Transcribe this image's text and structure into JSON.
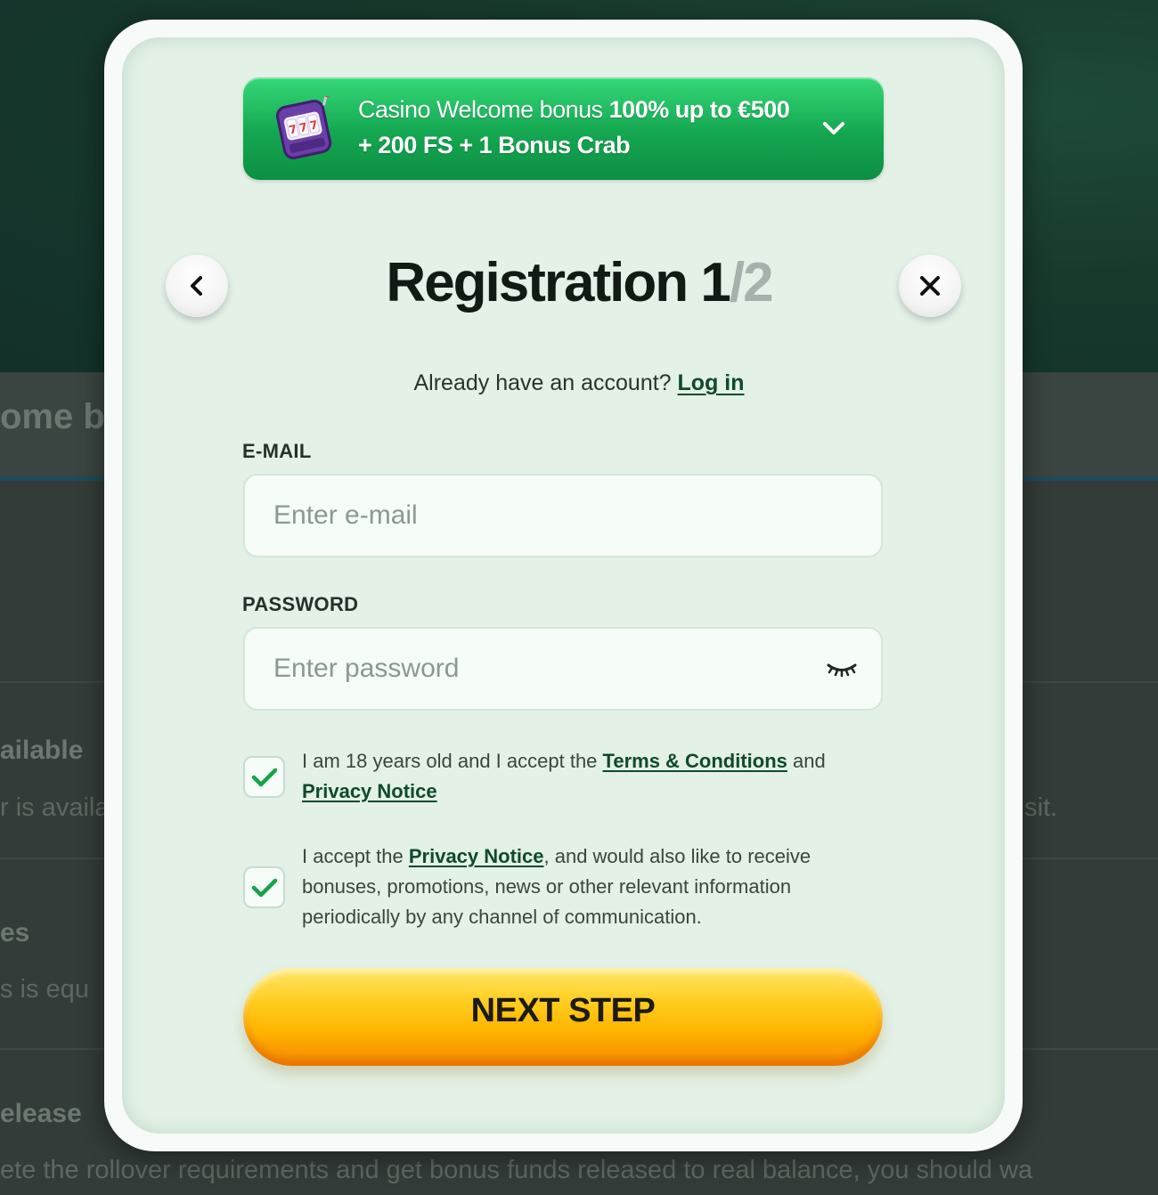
{
  "background": {
    "snippets": [
      "ome bo",
      "ailable",
      "r is availa",
      "sit.",
      "es",
      "s is equ",
      "elease",
      "ete the rollover requirements and get bonus funds released to real balance, you should wa"
    ]
  },
  "promo": {
    "text_regular": "Casino Welcome bonus ",
    "text_bold": "100% up to €500 + 200 FS + 1 Bonus Crab",
    "icon": "slot-machine-icon"
  },
  "header": {
    "title": "Registration",
    "step_current": "1",
    "step_separator": "/",
    "step_total": "2",
    "back_icon": "chevron-left-icon",
    "close_icon": "close-icon"
  },
  "login": {
    "prompt": "Already have an account?",
    "link": "Log in"
  },
  "form": {
    "email_label": "E-MAIL",
    "email_placeholder": "Enter e-mail",
    "email_value": "",
    "password_label": "PASSWORD",
    "password_placeholder": "Enter password",
    "password_value": "",
    "password_toggle_icon": "eye-closed-icon"
  },
  "consents": {
    "terms": {
      "checked": true,
      "prefix": "I am 18 years old and I accept the ",
      "terms_link": "Terms & Conditions",
      "middle": " and",
      "privacy_link": "Privacy Notice"
    },
    "marketing": {
      "checked": true,
      "prefix": "I accept the ",
      "privacy_link": "Privacy Notice",
      "suffix": ", and would also like to receive bonuses, promotions, news or other relevant information periodically by any channel of communication."
    }
  },
  "actions": {
    "next_label": "NEXT STEP"
  },
  "colors": {
    "promo_green": "#14a650",
    "modal_bg": "#e3f1e6",
    "link_green": "#0f4a2c",
    "button_orange": "#ffb300",
    "check_green": "#17a34a"
  }
}
